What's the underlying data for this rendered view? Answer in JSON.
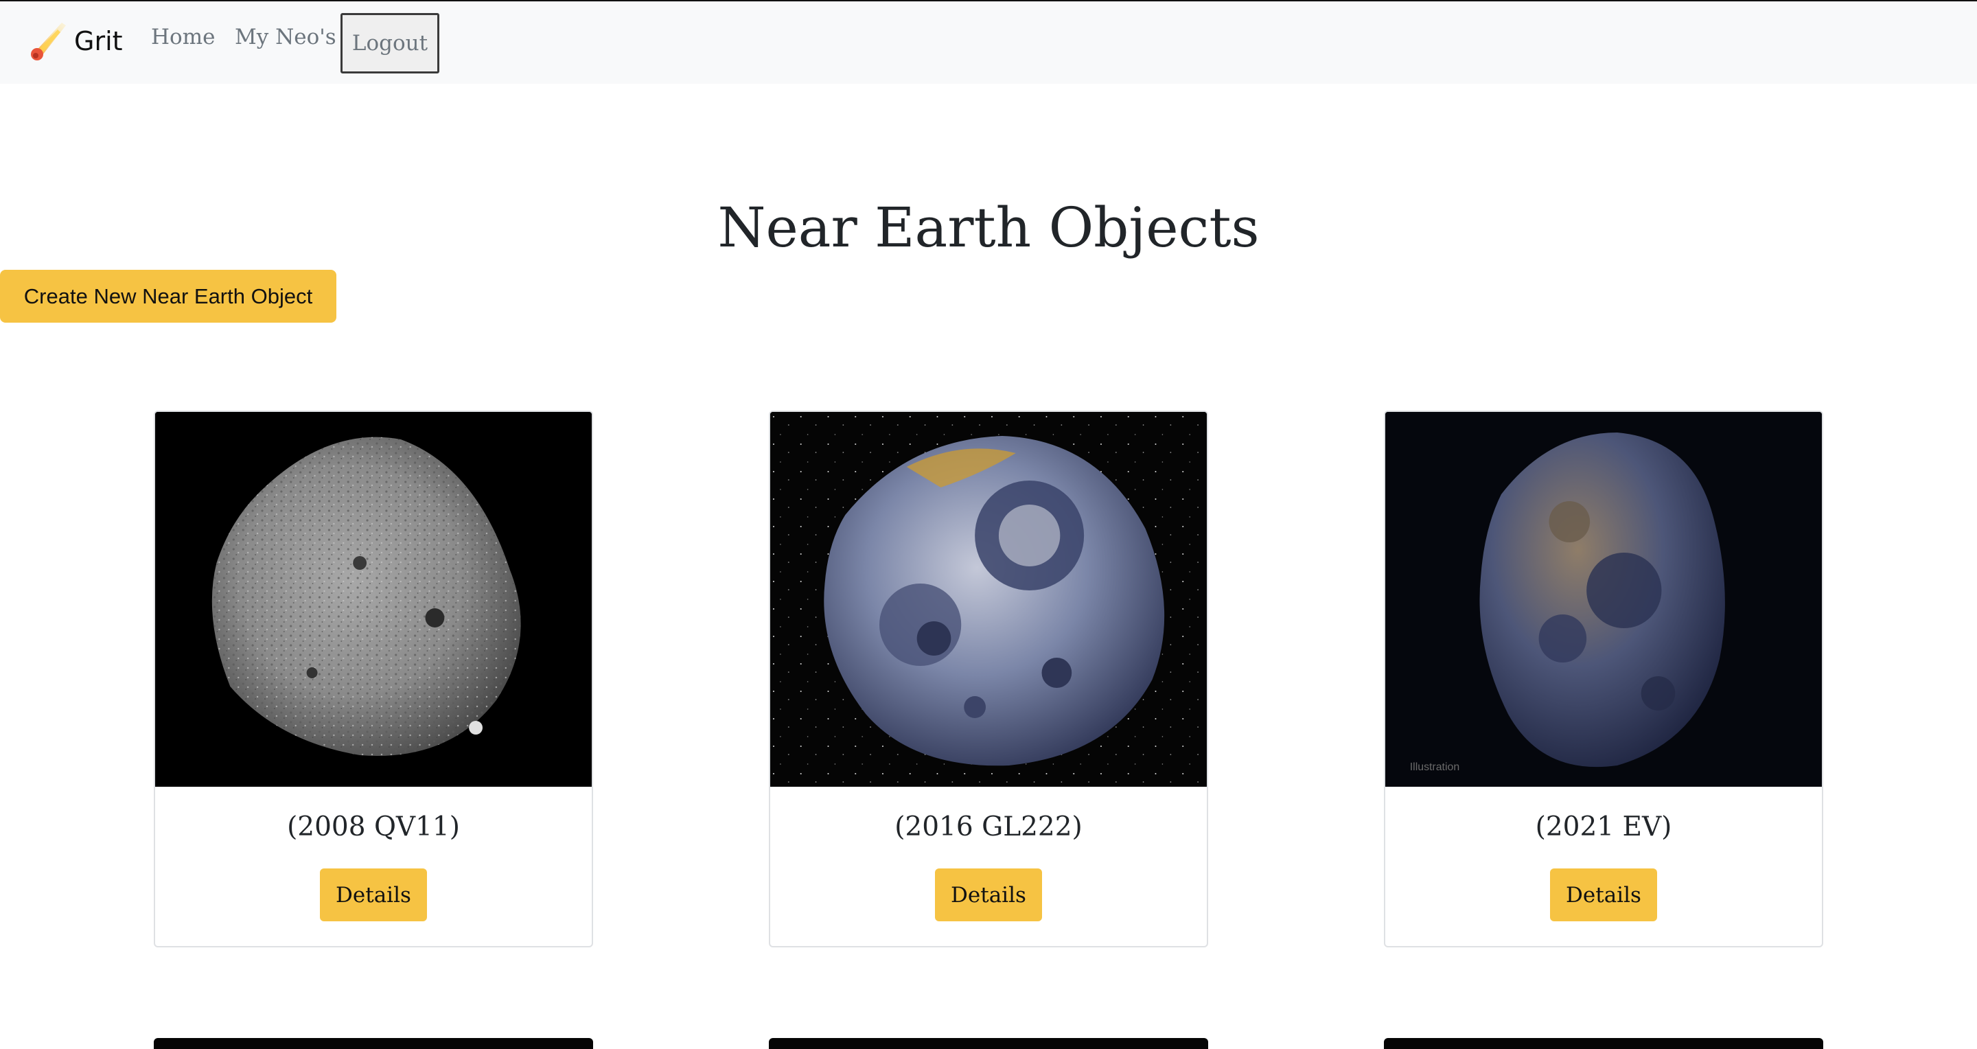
{
  "navbar": {
    "brand": "Grit",
    "links": [
      {
        "label": "Home"
      },
      {
        "label": "My Neo's"
      }
    ],
    "logout_label": "Logout"
  },
  "page": {
    "title": "Near Earth Objects",
    "create_button_label": "Create New Near Earth Object"
  },
  "cards": [
    {
      "name": "(2008 QV11)",
      "button_label": "Details",
      "image_caption": ""
    },
    {
      "name": "(2016 GL222)",
      "button_label": "Details",
      "image_caption": ""
    },
    {
      "name": "(2021 EV)",
      "button_label": "Details",
      "image_caption": "Illustration"
    }
  ],
  "colors": {
    "accent": "#f6c343",
    "navbar_bg": "#f8f9fa",
    "text": "#212529",
    "muted": "#6c757d"
  },
  "icons": {
    "brand": "comet-icon"
  }
}
